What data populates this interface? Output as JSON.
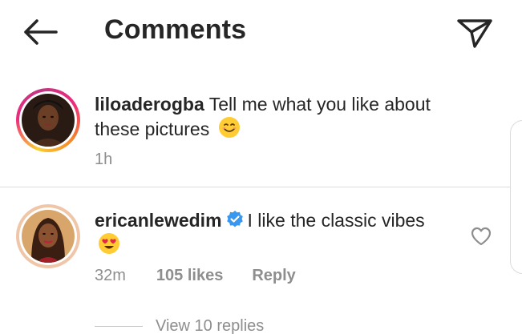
{
  "header": {
    "title": "Comments",
    "back_icon": "arrow-left-icon",
    "share_icon": "paper-plane-icon"
  },
  "comments": [
    {
      "username": "liloaderogba",
      "text": "Tell me what you like about these pictures",
      "emoji": "smiling-face-icon",
      "time": "1h",
      "avatar_ring": "story-gradient"
    },
    {
      "username": "ericanlewedim",
      "verified": true,
      "text": "I like the classic vibes",
      "emoji": "heart-eyes-face-icon",
      "time": "32m",
      "likes": "105 likes",
      "reply_label": "Reply",
      "view_replies": "View 10 replies"
    }
  ],
  "colors": {
    "text_primary": "#262626",
    "text_secondary": "#8e8e8e",
    "verified_blue": "#3897f0",
    "divider": "#dbdbdb"
  }
}
